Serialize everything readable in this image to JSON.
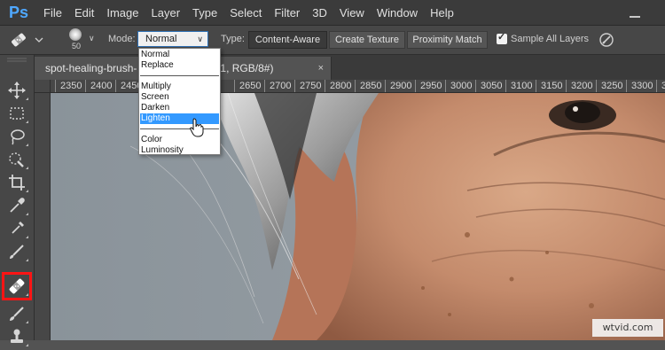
{
  "app": {
    "logo_text": "Ps"
  },
  "menu": [
    {
      "label": "File",
      "name": "menu-file"
    },
    {
      "label": "Edit",
      "name": "menu-edit"
    },
    {
      "label": "Image",
      "name": "menu-image"
    },
    {
      "label": "Layer",
      "name": "menu-layer"
    },
    {
      "label": "Type",
      "name": "menu-type"
    },
    {
      "label": "Select",
      "name": "menu-select"
    },
    {
      "label": "Filter",
      "name": "menu-filter"
    },
    {
      "label": "3D",
      "name": "menu-3d"
    },
    {
      "label": "View",
      "name": "menu-view"
    },
    {
      "label": "Window",
      "name": "menu-window"
    },
    {
      "label": "Help",
      "name": "menu-help"
    }
  ],
  "options": {
    "brush_size": "50",
    "mode_label": "Mode:",
    "mode_value": "Normal",
    "type_label": "Type:",
    "type_buttons": [
      {
        "label": "Content-Aware",
        "active": true
      },
      {
        "label": "Create Texture",
        "active": false
      },
      {
        "label": "Proximity Match",
        "active": false
      }
    ],
    "sample_all_layers_label": "Sample All Layers",
    "sample_all_layers_checked": true
  },
  "mode_dropdown": {
    "groups": [
      [
        "Normal",
        "Replace"
      ],
      [
        "Multiply",
        "Screen",
        "Darken",
        "Lighten"
      ],
      [
        "Color",
        "Luminosity"
      ]
    ],
    "highlighted": "Lighten"
  },
  "document": {
    "tab_title": "spot-healing-brush-                 (Layer 1, RGB/8#)",
    "tab_close": "×"
  },
  "ruler": {
    "labels": [
      "2350",
      "2400",
      "2450",
      "2650",
      "2700",
      "2750",
      "2800",
      "2850",
      "2900",
      "2950",
      "3000",
      "3050",
      "3100",
      "3150",
      "3200",
      "3250",
      "3300",
      "335"
    ]
  },
  "tools": [
    {
      "name": "move-tool-icon"
    },
    {
      "name": "marquee-tool-icon"
    },
    {
      "name": "lasso-tool-icon"
    },
    {
      "name": "quick-selection-tool-icon"
    },
    {
      "name": "crop-tool-icon"
    },
    {
      "name": "eyedropper-tool-icon"
    },
    {
      "name": "spot-healing-brush-tool-icon",
      "active": true
    },
    {
      "name": "brush-tool-icon"
    },
    {
      "name": "clone-stamp-tool-icon"
    },
    {
      "name": "history-brush-tool-icon"
    },
    {
      "name": "eraser-tool-icon"
    }
  ],
  "colors": {
    "menubar": "#3b3b3b",
    "panel": "#474747",
    "accent_select": "#3399ff",
    "highlight_box": "#ff1414",
    "ps_blue": "#4fa8ff"
  },
  "watermark": "wtvid.com"
}
